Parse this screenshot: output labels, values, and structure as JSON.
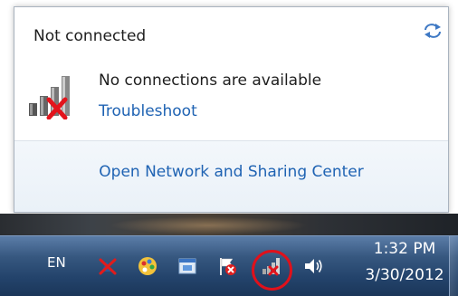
{
  "flyout": {
    "status_title": "Not connected",
    "message": "No connections are available",
    "troubleshoot_link": "Troubleshoot",
    "open_center_link": "Open Network and Sharing Center",
    "refresh_icon": "refresh-arrows-icon",
    "network_icon": "signal-bars-no-connection-icon"
  },
  "taskbar": {
    "language": "EN",
    "tray_icons": [
      "action-center-x-icon",
      "color-palette-icon",
      "app-window-icon",
      "flag-error-icon",
      "network-no-connection-icon",
      "speaker-volume-icon"
    ],
    "highlighted_icon": "network-no-connection-icon",
    "clock": {
      "time": "1:32 PM",
      "date": "3/30/2012"
    }
  },
  "colors": {
    "link": "#1f63b3",
    "highlight": "#e0111b",
    "taskbar": "#23436b"
  }
}
